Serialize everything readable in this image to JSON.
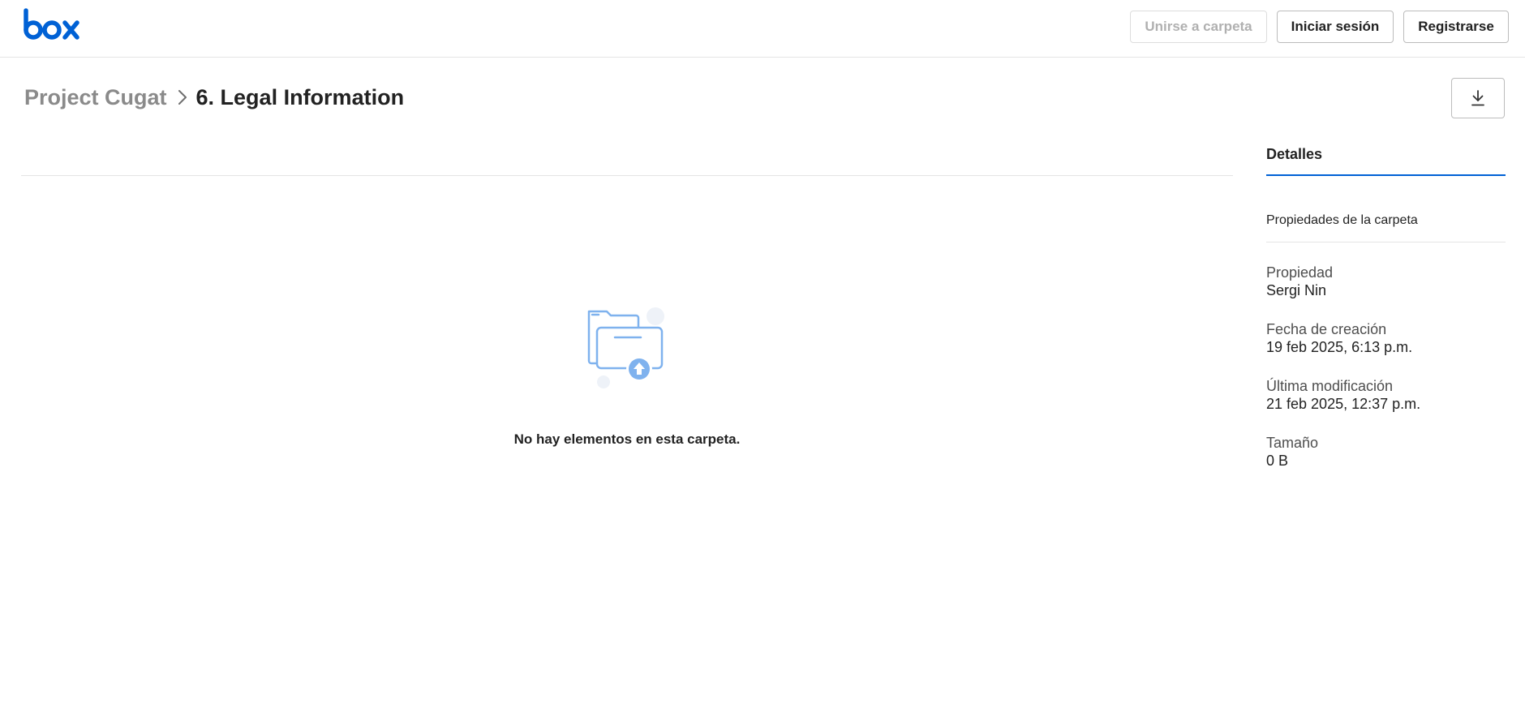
{
  "header": {
    "logo_text": "box",
    "join_folder_label": "Unirse a carpeta",
    "login_label": "Iniciar sesión",
    "register_label": "Registrarse"
  },
  "breadcrumb": {
    "parent": "Project Cugat",
    "current": "6. Legal Information"
  },
  "main": {
    "empty_message": "No hay elementos en esta carpeta."
  },
  "sidebar": {
    "tab_label": "Detalles",
    "section_title": "Propiedades de la carpeta",
    "properties": [
      {
        "label": "Propiedad",
        "value": "Sergi Nin"
      },
      {
        "label": "Fecha de creación",
        "value": "19 feb 2025, 6:13 p.m."
      },
      {
        "label": "Última modificación",
        "value": "21 feb 2025, 12:37 p.m."
      },
      {
        "label": "Tamaño",
        "value": "0 B"
      }
    ]
  },
  "colors": {
    "brand_blue": "#0061d5",
    "illustration_blue": "#7fb2ee",
    "border_gray": "#bcbcbc"
  },
  "icons": {
    "logo": "box-logo",
    "breadcrumb_separator": "chevron-right-icon",
    "download": "download-icon",
    "empty_state": "empty-folder-upload-icon"
  }
}
